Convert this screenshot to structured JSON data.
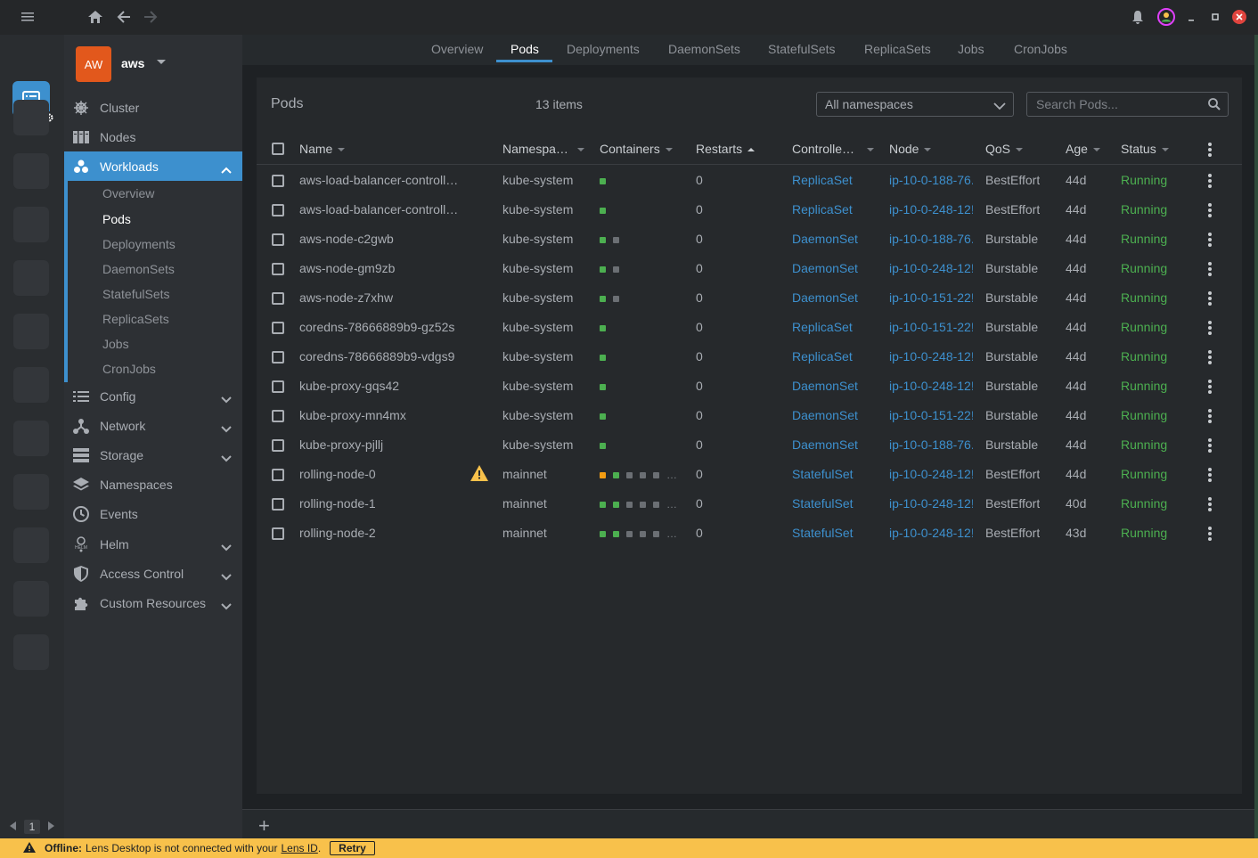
{
  "titlebar": {
    "menu_icon": "hamburger-icon",
    "home_icon": "home-icon",
    "back_icon": "arrow-left-icon",
    "forward_icon": "arrow-right-icon"
  },
  "hotbar": {
    "page": "1"
  },
  "cluster": {
    "avatar": "AW",
    "name": "aws"
  },
  "sidebar": {
    "items": [
      {
        "label": "Cluster",
        "icon": "helm-wheel-icon"
      },
      {
        "label": "Nodes",
        "icon": "nodes-icon"
      },
      {
        "label": "Workloads",
        "icon": "workloads-icon"
      },
      {
        "label": "Config",
        "icon": "list-icon"
      },
      {
        "label": "Network",
        "icon": "network-icon"
      },
      {
        "label": "Storage",
        "icon": "storage-icon"
      },
      {
        "label": "Namespaces",
        "icon": "layers-icon"
      },
      {
        "label": "Events",
        "icon": "clock-icon"
      },
      {
        "label": "Helm",
        "icon": "helm-icon"
      },
      {
        "label": "Access Control",
        "icon": "shield-icon"
      },
      {
        "label": "Custom Resources",
        "icon": "puzzle-icon"
      }
    ],
    "workloads_sub": [
      "Overview",
      "Pods",
      "Deployments",
      "DaemonSets",
      "StatefulSets",
      "ReplicaSets",
      "Jobs",
      "CronJobs"
    ]
  },
  "tabs": [
    "Overview",
    "Pods",
    "Deployments",
    "DaemonSets",
    "StatefulSets",
    "ReplicaSets",
    "Jobs",
    "CronJobs"
  ],
  "panel": {
    "title": "Pods",
    "count": "13 items",
    "namespace_select": "All namespaces",
    "search_placeholder": "Search Pods..."
  },
  "columns": [
    "Name",
    "Namespa…",
    "Containers",
    "Restarts",
    "Controlle…",
    "Node",
    "QoS",
    "Age",
    "Status"
  ],
  "colors": {
    "accent": "#3d90ce",
    "running": "#4caf50",
    "container_ok": "#4caf50",
    "container_pending": "#6b6f74",
    "container_warn": "#f39c12",
    "offline_bar": "#f8c14b"
  },
  "pods": [
    {
      "name": "aws-load-balancer-controlle…",
      "namespace": "kube-system",
      "containers": [
        "ok"
      ],
      "restarts": "0",
      "controller": "ReplicaSet",
      "node": "ip-10-0-188-76.",
      "qos": "BestEffort",
      "age": "44d",
      "status": "Running",
      "warning": false
    },
    {
      "name": "aws-load-balancer-controlle…",
      "namespace": "kube-system",
      "containers": [
        "ok"
      ],
      "restarts": "0",
      "controller": "ReplicaSet",
      "node": "ip-10-0-248-12!",
      "qos": "BestEffort",
      "age": "44d",
      "status": "Running",
      "warning": false
    },
    {
      "name": "aws-node-c2gwb",
      "namespace": "kube-system",
      "containers": [
        "ok",
        "pending"
      ],
      "restarts": "0",
      "controller": "DaemonSet",
      "node": "ip-10-0-188-76.",
      "qos": "Burstable",
      "age": "44d",
      "status": "Running",
      "warning": false
    },
    {
      "name": "aws-node-gm9zb",
      "namespace": "kube-system",
      "containers": [
        "ok",
        "pending"
      ],
      "restarts": "0",
      "controller": "DaemonSet",
      "node": "ip-10-0-248-12!",
      "qos": "Burstable",
      "age": "44d",
      "status": "Running",
      "warning": false
    },
    {
      "name": "aws-node-z7xhw",
      "namespace": "kube-system",
      "containers": [
        "ok",
        "pending"
      ],
      "restarts": "0",
      "controller": "DaemonSet",
      "node": "ip-10-0-151-22!",
      "qos": "Burstable",
      "age": "44d",
      "status": "Running",
      "warning": false
    },
    {
      "name": "coredns-78666889b9-gz52s",
      "namespace": "kube-system",
      "containers": [
        "ok"
      ],
      "restarts": "0",
      "controller": "ReplicaSet",
      "node": "ip-10-0-151-22!",
      "qos": "Burstable",
      "age": "44d",
      "status": "Running",
      "warning": false
    },
    {
      "name": "coredns-78666889b9-vdgs9",
      "namespace": "kube-system",
      "containers": [
        "ok"
      ],
      "restarts": "0",
      "controller": "ReplicaSet",
      "node": "ip-10-0-248-12!",
      "qos": "Burstable",
      "age": "44d",
      "status": "Running",
      "warning": false
    },
    {
      "name": "kube-proxy-gqs42",
      "namespace": "kube-system",
      "containers": [
        "ok"
      ],
      "restarts": "0",
      "controller": "DaemonSet",
      "node": "ip-10-0-248-12!",
      "qos": "Burstable",
      "age": "44d",
      "status": "Running",
      "warning": false
    },
    {
      "name": "kube-proxy-mn4mx",
      "namespace": "kube-system",
      "containers": [
        "ok"
      ],
      "restarts": "0",
      "controller": "DaemonSet",
      "node": "ip-10-0-151-22!",
      "qos": "Burstable",
      "age": "44d",
      "status": "Running",
      "warning": false
    },
    {
      "name": "kube-proxy-pjllj",
      "namespace": "kube-system",
      "containers": [
        "ok"
      ],
      "restarts": "0",
      "controller": "DaemonSet",
      "node": "ip-10-0-188-76.",
      "qos": "Burstable",
      "age": "44d",
      "status": "Running",
      "warning": false
    },
    {
      "name": "rolling-node-0",
      "namespace": "mainnet",
      "containers": [
        "warn",
        "ok",
        "pending",
        "pending",
        "pending",
        "more"
      ],
      "restarts": "0",
      "controller": "StatefulSet",
      "node": "ip-10-0-248-12!",
      "qos": "BestEffort",
      "age": "44d",
      "status": "Running",
      "warning": true
    },
    {
      "name": "rolling-node-1",
      "namespace": "mainnet",
      "containers": [
        "ok",
        "ok",
        "pending",
        "pending",
        "pending",
        "more"
      ],
      "restarts": "0",
      "controller": "StatefulSet",
      "node": "ip-10-0-248-12!",
      "qos": "BestEffort",
      "age": "40d",
      "status": "Running",
      "warning": false
    },
    {
      "name": "rolling-node-2",
      "namespace": "mainnet",
      "containers": [
        "ok",
        "ok",
        "pending",
        "pending",
        "pending",
        "more"
      ],
      "restarts": "0",
      "controller": "StatefulSet",
      "node": "ip-10-0-248-12!",
      "qos": "BestEffort",
      "age": "43d",
      "status": "Running",
      "warning": false
    }
  ],
  "statusbar": {
    "offline_label": "Offline:",
    "message": "Lens Desktop is not connected with your",
    "link": "Lens ID",
    "period": ".",
    "retry": "Retry"
  }
}
